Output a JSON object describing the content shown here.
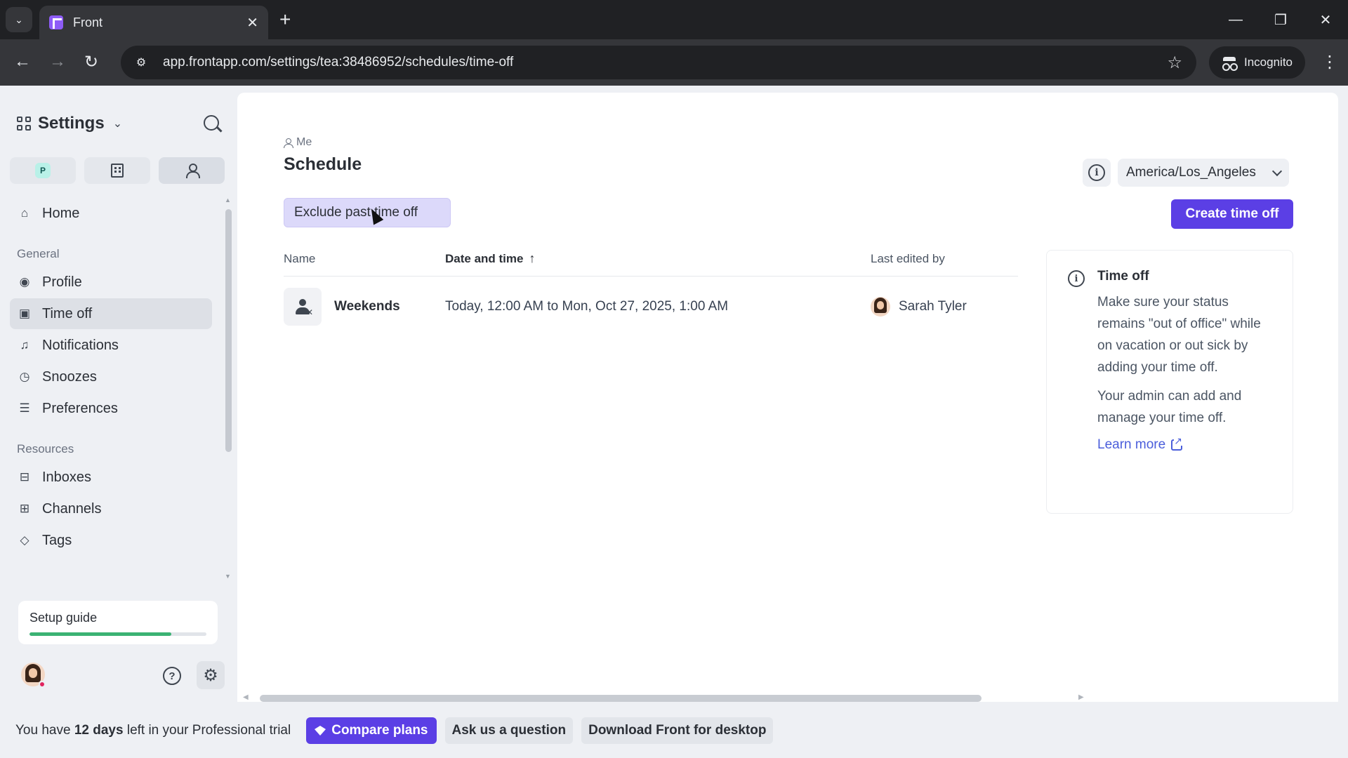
{
  "browser": {
    "tab_title": "Front",
    "url": "app.frontapp.com/settings/tea:38486952/schedules/time-off",
    "incognito_label": "Incognito"
  },
  "sidebar": {
    "title": "Settings",
    "scope_badge": "P",
    "nav": {
      "home": "Home",
      "general_header": "General",
      "profile": "Profile",
      "time_off": "Time off",
      "notifications": "Notifications",
      "snoozes": "Snoozes",
      "preferences": "Preferences",
      "resources_header": "Resources",
      "inboxes": "Inboxes",
      "channels": "Channels",
      "tags": "Tags"
    },
    "setup_guide": {
      "label": "Setup guide",
      "progress": 0.8
    }
  },
  "main": {
    "breadcrumb": "Me",
    "title": "Schedule",
    "timezone": "America/Los_Angeles",
    "exclude_label": "Exclude past time off",
    "create_label": "Create time off",
    "table": {
      "headers": {
        "name": "Name",
        "date": "Date and time",
        "edited": "Last edited by"
      },
      "rows": [
        {
          "name": "Weekends",
          "date": "Today, 12:00 AM to Mon, Oct 27, 2025, 1:00 AM",
          "edited_by": "Sarah Tyler"
        }
      ]
    },
    "info_card": {
      "title": "Time off",
      "p1": "Make sure your status remains \"out of office\" while on vacation or out sick by adding your time off.",
      "p2": "Your admin can add and manage your time off.",
      "link": "Learn more"
    }
  },
  "trial": {
    "prefix": "You have ",
    "days": "12 days",
    "suffix": " left in your Professional trial",
    "compare": "Compare plans",
    "ask": "Ask us a question",
    "download": "Download Front for desktop"
  },
  "colors": {
    "accent": "#5b3fe5",
    "link": "#4b5edb",
    "progress": "#3bb273"
  }
}
